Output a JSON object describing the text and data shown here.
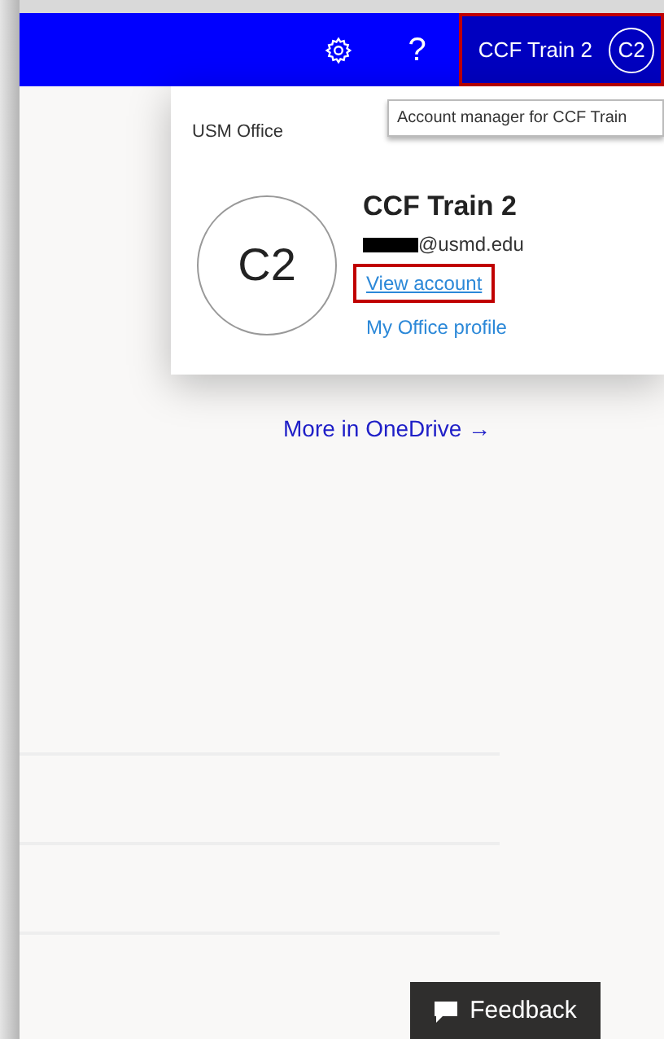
{
  "header": {
    "help": "?",
    "account": {
      "name": "CCF Train 2",
      "initials": "C2",
      "highlighted": true
    }
  },
  "account_panel": {
    "org": "USM Office",
    "tooltip": "Account manager for CCF Train",
    "initials": "C2",
    "name": "CCF Train 2",
    "email_redacted": true,
    "email": "@usmd.edu",
    "links": [
      {
        "label": "View account",
        "highlighted": true
      },
      {
        "label": "My Office profile",
        "highlighted": false
      }
    ]
  },
  "more_link": "More in OneDrive",
  "more_arrow": "→",
  "feedback": "Feedback"
}
